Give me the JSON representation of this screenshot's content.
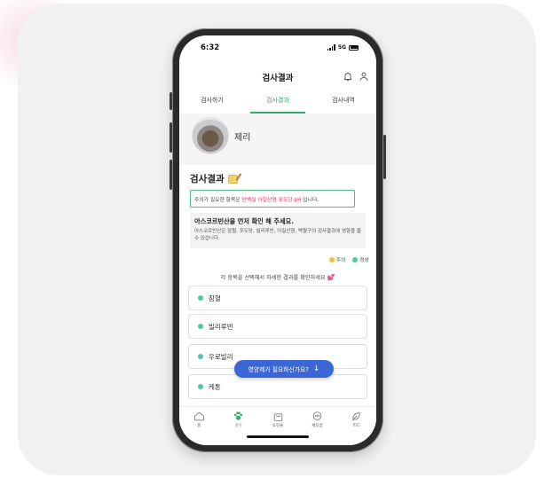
{
  "colors": {
    "accent": "#3aaa6a",
    "warning": "#f2c230",
    "normal": "#4fc8a8",
    "highlight": "#e0335a",
    "cta": "#3a66d6"
  },
  "status_bar": {
    "time": "6:32",
    "network": "5G"
  },
  "header": {
    "title": "검사결과",
    "icons": [
      "bell-icon",
      "user-icon"
    ],
    "tabs": [
      {
        "label": "검사하기",
        "active": false
      },
      {
        "label": "검사결과",
        "active": true
      },
      {
        "label": "검사내역",
        "active": false
      }
    ]
  },
  "profile": {
    "name": "제리"
  },
  "results": {
    "title": "검사결과",
    "notice": {
      "prefix": "주의가 필요한 항목은 ",
      "highlight": "단백질 아질산염 포도당 pH",
      "suffix": " 입니다."
    },
    "advice": {
      "title": "아스코르빈산을 먼저 확인 해 주세요.",
      "text": "아스코르빈산은 잠혈, 포도당, 빌리루빈, 아질산염, 백혈구의 검사결과에 영향을 줄 수 있습니다."
    },
    "legend": {
      "warning": "주의",
      "normal": "정상"
    },
    "guide": "각 항목을 선택해서 자세한 결과를 확인하세요",
    "items": [
      {
        "label": "잠혈",
        "status": "normal"
      },
      {
        "label": "빌리루빈",
        "status": "normal"
      },
      {
        "label": "우로빌리",
        "status": "normal"
      },
      {
        "label": "케톤",
        "status": "normal"
      }
    ],
    "cta": "영양제가 필요하신가요?"
  },
  "bottom_nav": [
    {
      "label": "홈",
      "icon": "home-icon",
      "active": false
    },
    {
      "label": "검사",
      "icon": "paw-icon",
      "active": true
    },
    {
      "label": "쇼핑몰",
      "icon": "bag-icon",
      "active": false
    },
    {
      "label": "채팅샵",
      "icon": "chat-icon",
      "active": false
    },
    {
      "label": "피드",
      "icon": "leaf-icon",
      "active": false
    }
  ]
}
